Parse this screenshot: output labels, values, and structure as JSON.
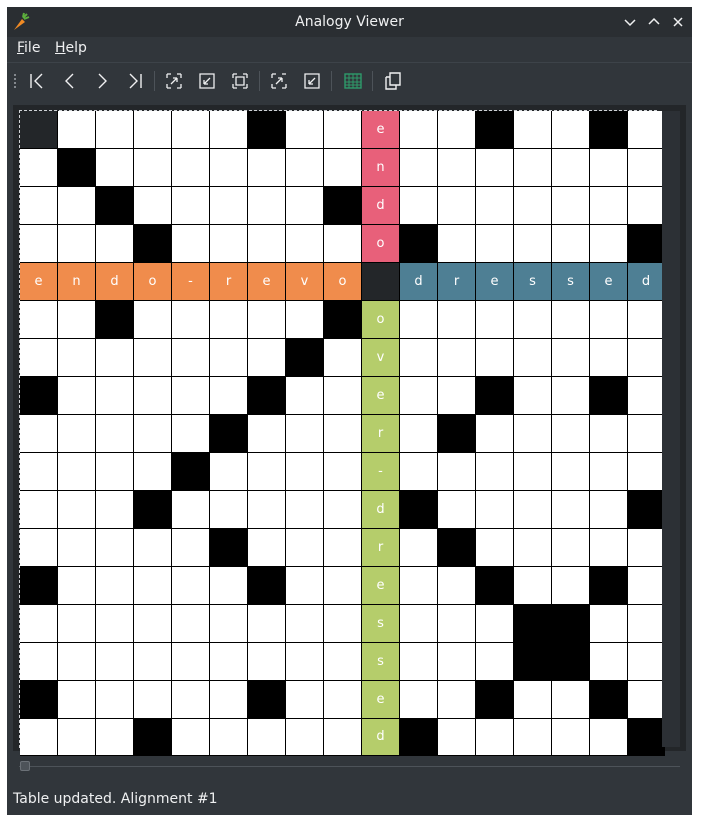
{
  "window": {
    "title": "Analogy Viewer",
    "app_icon": "carrot-icon",
    "controls": [
      "minimize-icon",
      "maximize-icon",
      "close-icon"
    ]
  },
  "menu": {
    "items": [
      {
        "label": "File",
        "mnemonic_index": 0
      },
      {
        "label": "Help",
        "mnemonic_index": 0
      }
    ]
  },
  "toolbar": {
    "buttons": [
      {
        "name": "first-alignment-button",
        "icon": "first-icon"
      },
      {
        "name": "previous-alignment-button",
        "icon": "previous-icon"
      },
      {
        "name": "next-alignment-button",
        "icon": "next-icon"
      },
      {
        "name": "last-alignment-button",
        "icon": "last-icon"
      },
      {
        "name": "zoom-in-button",
        "icon": "zoom-in-icon"
      },
      {
        "name": "zoom-out-button",
        "icon": "zoom-out-icon"
      },
      {
        "name": "zoom-fit-button",
        "icon": "zoom-fit-icon"
      },
      {
        "name": "zoom-in-alt-button",
        "icon": "zoom-in-alt-icon"
      },
      {
        "name": "zoom-out-alt-button",
        "icon": "zoom-out-alt-icon"
      },
      {
        "name": "table-view-button",
        "icon": "table-icon"
      },
      {
        "name": "copy-button",
        "icon": "copy-icon"
      }
    ]
  },
  "grid": {
    "rows": 17,
    "cols": 17,
    "colors": {
      "top_word": "#e8607a",
      "left_word": "#f08c4c",
      "right_word": "#4e7f94",
      "bottom_word": "#b5cd6b",
      "center": "#232629",
      "corner": "#232629",
      "filled": "#000000",
      "empty": "#ffffff"
    },
    "corner_cell": [
      0,
      0
    ],
    "pivot": [
      4,
      9
    ],
    "top_word": "endo",
    "left_word": "endo-revo",
    "right_word": "dressed",
    "bottom_word": "over-dressed",
    "filled_cells": [
      [
        0,
        6
      ],
      [
        0,
        12
      ],
      [
        0,
        15
      ],
      [
        1,
        1
      ],
      [
        2,
        2
      ],
      [
        2,
        8
      ],
      [
        3,
        3
      ],
      [
        3,
        10
      ],
      [
        3,
        16
      ],
      [
        5,
        2
      ],
      [
        5,
        8
      ],
      [
        6,
        7
      ],
      [
        7,
        0
      ],
      [
        7,
        6
      ],
      [
        7,
        12
      ],
      [
        7,
        15
      ],
      [
        8,
        5
      ],
      [
        8,
        11
      ],
      [
        9,
        4
      ],
      [
        10,
        3
      ],
      [
        10,
        10
      ],
      [
        10,
        16
      ],
      [
        11,
        5
      ],
      [
        11,
        11
      ],
      [
        12,
        0
      ],
      [
        12,
        6
      ],
      [
        12,
        12
      ],
      [
        12,
        15
      ],
      [
        13,
        13
      ],
      [
        13,
        14
      ],
      [
        14,
        13
      ],
      [
        14,
        14
      ],
      [
        15,
        0
      ],
      [
        15,
        6
      ],
      [
        15,
        12
      ],
      [
        15,
        15
      ],
      [
        16,
        3
      ],
      [
        16,
        10
      ],
      [
        16,
        16
      ]
    ]
  },
  "status": {
    "text": "Table updated. Alignment #1"
  }
}
